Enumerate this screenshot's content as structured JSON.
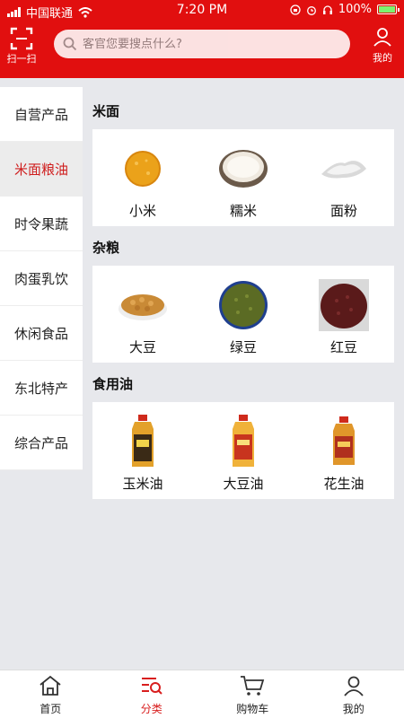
{
  "status": {
    "carrier": "中国联通",
    "time": "7:20 PM",
    "battery": "100%"
  },
  "header": {
    "scan_label": "扫一扫",
    "search_placeholder": "客官您要搜点什么?",
    "mine_label": "我的"
  },
  "sidebar": {
    "items": [
      {
        "label": "自营产品"
      },
      {
        "label": "米面粮油"
      },
      {
        "label": "时令果蔬"
      },
      {
        "label": "肉蛋乳饮"
      },
      {
        "label": "休闲食品"
      },
      {
        "label": "东北特产"
      },
      {
        "label": "综合产品"
      }
    ],
    "active_index": 1
  },
  "sections": [
    {
      "title": "米面",
      "items": [
        {
          "name": "小米"
        },
        {
          "name": "糯米"
        },
        {
          "name": "面粉"
        }
      ]
    },
    {
      "title": "杂粮",
      "items": [
        {
          "name": "大豆"
        },
        {
          "name": "绿豆"
        },
        {
          "name": "红豆"
        }
      ]
    },
    {
      "title": "食用油",
      "items": [
        {
          "name": "玉米油"
        },
        {
          "name": "大豆油"
        },
        {
          "name": "花生油"
        }
      ]
    }
  ],
  "tabbar": {
    "items": [
      {
        "label": "首页",
        "icon": "home-icon"
      },
      {
        "label": "分类",
        "icon": "category-icon"
      },
      {
        "label": "购物车",
        "icon": "cart-icon"
      },
      {
        "label": "我的",
        "icon": "user-icon"
      }
    ],
    "active_index": 1
  },
  "colors": {
    "brand": "#e10f0f",
    "active_text": "#cf1e1e"
  }
}
